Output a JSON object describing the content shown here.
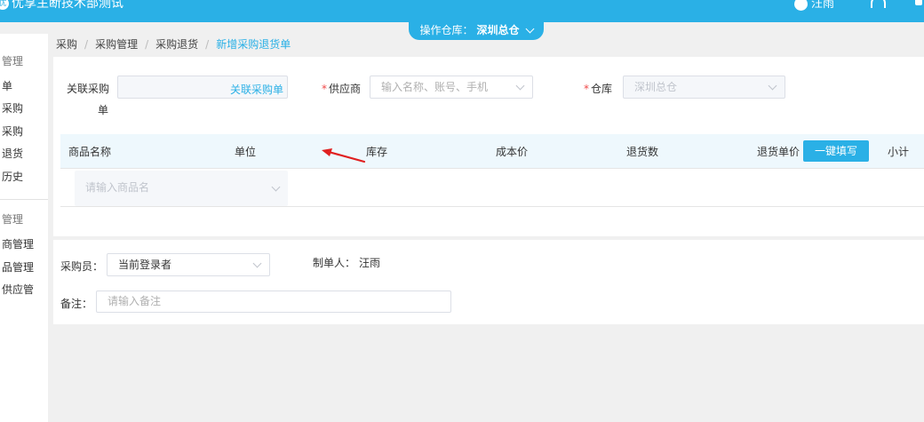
{
  "header": {
    "brand": "优享主断技术部测试",
    "user": "汪雨",
    "warehouse_label": "操作仓库：",
    "warehouse_value": "深圳总仓"
  },
  "sidebar": {
    "items": [
      "管理",
      "单",
      "采购",
      "采购",
      "退货",
      "历史",
      "管理",
      "商管理",
      "品管理",
      "供应管"
    ]
  },
  "breadcrumb": [
    "采购",
    "采购管理",
    "采购退货",
    "新增采购退货单"
  ],
  "form": {
    "related_label_line1": "关联采购",
    "related_label_line2": "单",
    "related_link": "关联采购单",
    "supplier_label": "供应商",
    "supplier_placeholder": "输入名称、账号、手机",
    "warehouse_label": "仓库",
    "warehouse_value": "深圳总仓"
  },
  "table": {
    "columns": [
      "商品名称",
      "单位",
      "库存",
      "成本价",
      "退货数",
      "退货单价",
      "小计"
    ],
    "fill_button": "一键填写",
    "product_placeholder": "请输入商品名"
  },
  "footer": {
    "buyer_label": "采购员：",
    "buyer_value": "当前登录者",
    "creator_label": "制单人：",
    "creator_value": "汪雨",
    "note_label": "备注：",
    "note_placeholder": "请输入备注"
  },
  "colors": {
    "accent": "#2ab0e6",
    "required": "#f04848",
    "arrow": "#e02020"
  },
  "icons": [
    "brand-logo-icon",
    "user-avatar-icon",
    "headset-icon",
    "more-icon",
    "chevron-down-icon",
    "red-arrow-icon"
  ]
}
